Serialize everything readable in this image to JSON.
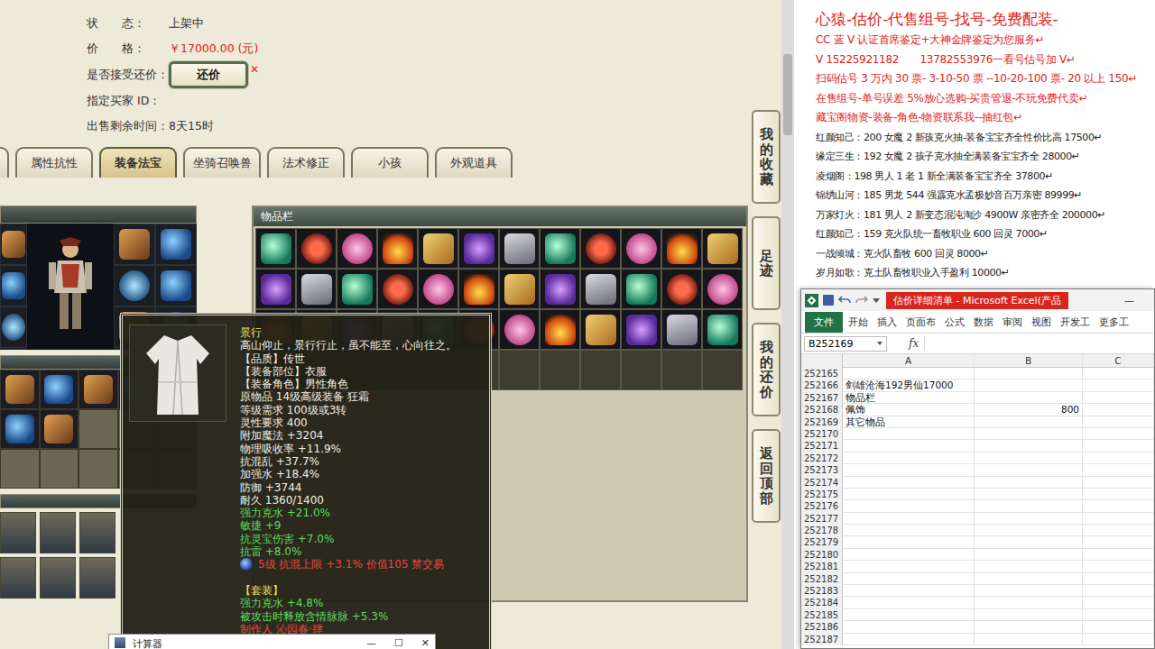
{
  "listing": {
    "fields": [
      {
        "label": "状　　态：",
        "value": "上架中",
        "kind": "plain"
      },
      {
        "label": "价　　格：",
        "value": "￥17000.00 (元)",
        "kind": "price"
      },
      {
        "label": "是否接受还价：",
        "value": "还价",
        "kind": "button",
        "mark": "✕"
      },
      {
        "label": "指定买家 ID：",
        "value": "",
        "kind": "plain"
      },
      {
        "label": "出售剩余时间：",
        "value": "8天15时",
        "kind": "plain"
      }
    ]
  },
  "tabs": [
    {
      "label": "属性抗性",
      "selected": false
    },
    {
      "label": "装备法宝",
      "selected": true
    },
    {
      "label": "坐骑召唤兽",
      "selected": false
    },
    {
      "label": "法术修正",
      "selected": false
    },
    {
      "label": "小孩",
      "selected": false
    },
    {
      "label": "外观道具",
      "selected": false
    }
  ],
  "side_buttons": [
    "我的收藏",
    "足迹",
    "我的还价",
    "返回顶部"
  ],
  "equipment": {
    "left_slots": 3,
    "right_slots": 6,
    "bag_filled": 7,
    "bag_slots": 15,
    "pets": 6
  },
  "inventory": {
    "title": "物品栏",
    "filled_slots": 36,
    "total_slots": 48
  },
  "tooltip": {
    "lines": [
      {
        "text": "景行",
        "kind": "title"
      },
      {
        "text": "高山仰止，景行行止，虽不能至，心向往之。",
        "kind": "text"
      },
      {
        "text": "【品质】传世",
        "kind": "text"
      },
      {
        "text": "【装备部位】衣服",
        "kind": "text"
      },
      {
        "text": "【装备角色】男性角色",
        "kind": "text"
      },
      {
        "text": "原物品 14级高级装备 狂霜",
        "kind": "text"
      },
      {
        "text": "等级需求 100级或3转",
        "kind": "text"
      },
      {
        "text": "灵性要求 400",
        "kind": "text"
      },
      {
        "text": "附加魔法 +3204",
        "kind": "text"
      },
      {
        "text": "物理吸收率 +11.9%",
        "kind": "text"
      },
      {
        "text": "抗混乱 +37.7%",
        "kind": "text"
      },
      {
        "text": "加强水 +18.4%",
        "kind": "text"
      },
      {
        "text": "防御 +3744",
        "kind": "text"
      },
      {
        "text": "耐久 1360/1400",
        "kind": "text"
      },
      {
        "text": "强力克水 +21.0%",
        "kind": "green"
      },
      {
        "text": "敏捷 +9",
        "kind": "green"
      },
      {
        "text": "抗灵宝伤害 +7.0%",
        "kind": "green"
      },
      {
        "text": "抗雷 +8.0%",
        "kind": "green"
      },
      {
        "text": "5级 抗混上限 +3.1% 价值105 禁交易",
        "kind": "gem"
      },
      {
        "text": "",
        "kind": "blank"
      },
      {
        "text": "【套装】",
        "kind": "title"
      },
      {
        "text": "强力克水 +4.8%",
        "kind": "green"
      },
      {
        "text": "被攻击时释放含情脉脉 +5.3%",
        "kind": "green"
      },
      {
        "text": "制作人 沁园春·肆",
        "kind": "maker"
      }
    ]
  },
  "calculator": {
    "title": "计算器",
    "controls": [
      "—",
      "☐",
      "✕"
    ]
  },
  "ad": {
    "title": "心猿-估价-代售组号-找号-免费配装-",
    "promo_lines": [
      "CC 蓝 V 认证首席鉴定+大神金牌鉴定为您服务↵",
      "V 15225921182　　13782553976一看号估号加 V↵",
      "扫码估号 3 万内 30 票- 3-10-50 票 --10-20-100 票- 20 以上 150↵",
      "在售组号-单号误差 5%放心选购-买贵管退-不玩免费代卖↵",
      "藏宝阁物资-装备-角色-物资联系我--抽红包↵"
    ],
    "listing_lines": [
      "红颜知己：200 女魔 2 新孩克火抽-装备宝宝齐全性价比高 17500↵",
      "缘定三生：192 女魔 2 孩子克水抽全满装备宝宝齐全 28000↵",
      "凌烟阁：198 男人 1 老 1 新全满装备宝宝齐全 37800↵",
      "锦绣山河：185 男龙 544 强霹克水孟极妙音百万亲密 89999↵",
      "万家灯火：181 男人 2 新变态混沌淘沙 4900W 亲密齐全 200000↵",
      "红颜知己：159 克火队统一畜牧职业 600 回灵 7000↵",
      "一战倾城：克火队畜牧 600 回灵 8000↵",
      "岁月如歌：克土队畜牧职业入手盈利 10000↵"
    ]
  },
  "excel": {
    "title": "估价详细清单 - Microsoft Excel(产品",
    "window_controls": [
      "—"
    ],
    "ribbon_tabs": [
      {
        "label": "文件",
        "selected": true
      },
      {
        "label": "开始",
        "selected": false
      },
      {
        "label": "插入",
        "selected": false
      },
      {
        "label": "页面布",
        "selected": false
      },
      {
        "label": "公式",
        "selected": false
      },
      {
        "label": "数据",
        "selected": false
      },
      {
        "label": "审阅",
        "selected": false
      },
      {
        "label": "视图",
        "selected": false
      },
      {
        "label": "开发工",
        "selected": false
      },
      {
        "label": "更多工",
        "selected": false
      }
    ],
    "name_box": "B252169",
    "formula_label": "fx",
    "columns": [
      "A",
      "B",
      "C"
    ],
    "rows": [
      {
        "num": "252165",
        "a": "",
        "b": ""
      },
      {
        "num": "252166",
        "a": "剑雄沧海192男仙17000",
        "b": ""
      },
      {
        "num": "252167",
        "a": "物品栏",
        "b": ""
      },
      {
        "num": "252168",
        "a": "佩饰",
        "b": "800"
      },
      {
        "num": "252169",
        "a": "其它物品",
        "b": ""
      },
      {
        "num": "252170",
        "a": "",
        "b": ""
      },
      {
        "num": "252171",
        "a": "",
        "b": ""
      },
      {
        "num": "252172",
        "a": "",
        "b": ""
      },
      {
        "num": "252173",
        "a": "",
        "b": ""
      },
      {
        "num": "252174",
        "a": "",
        "b": ""
      },
      {
        "num": "252175",
        "a": "",
        "b": ""
      },
      {
        "num": "252176",
        "a": "",
        "b": ""
      },
      {
        "num": "252177",
        "a": "",
        "b": ""
      },
      {
        "num": "252178",
        "a": "",
        "b": ""
      },
      {
        "num": "252179",
        "a": "",
        "b": ""
      },
      {
        "num": "252180",
        "a": "",
        "b": ""
      },
      {
        "num": "252181",
        "a": "",
        "b": ""
      },
      {
        "num": "252182",
        "a": "",
        "b": ""
      },
      {
        "num": "252183",
        "a": "",
        "b": ""
      },
      {
        "num": "252184",
        "a": "",
        "b": ""
      },
      {
        "num": "252185",
        "a": "",
        "b": ""
      },
      {
        "num": "252186",
        "a": "",
        "b": ""
      },
      {
        "num": "252187",
        "a": "",
        "b": ""
      }
    ]
  }
}
